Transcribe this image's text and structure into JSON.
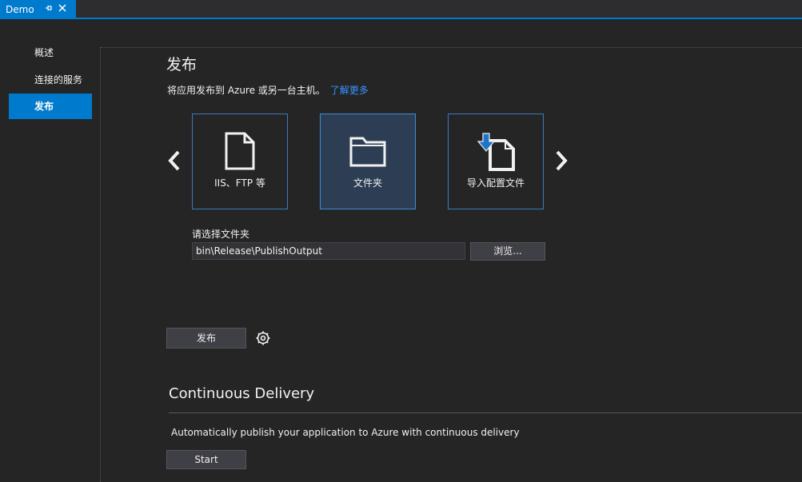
{
  "tab": {
    "title": "Demo",
    "pin_icon": "pin-icon",
    "close_icon": "close-icon"
  },
  "nav": {
    "items": [
      {
        "label": "概述",
        "active": false
      },
      {
        "label": "连接的服务",
        "active": false
      },
      {
        "label": "发布",
        "active": true
      }
    ]
  },
  "main": {
    "title": "发布",
    "subtitle": "将应用发布到 Azure 或另一台主机。",
    "learn_more": "了解更多",
    "targets": [
      {
        "label": "IIS、FTP 等",
        "icon": "document-icon",
        "selected": false
      },
      {
        "label": "文件夹",
        "icon": "folder-icon",
        "selected": true
      },
      {
        "label": "导入配置文件",
        "icon": "import-profile-icon",
        "selected": false
      }
    ],
    "folder_label": "请选择文件夹",
    "folder_path": "bin\\Release\\PublishOutput",
    "browse_label": "浏览...",
    "publish_label": "发布",
    "settings_icon": "gear-icon"
  },
  "continuous_delivery": {
    "title": "Continuous Delivery",
    "description": "Automatically publish your application to Azure with continuous delivery",
    "start_label": "Start"
  },
  "colors": {
    "accent": "#007acc",
    "background": "#252526",
    "card_border": "#3a7abf",
    "card_selected_bg": "#2d3e54",
    "link": "#3794ff"
  }
}
